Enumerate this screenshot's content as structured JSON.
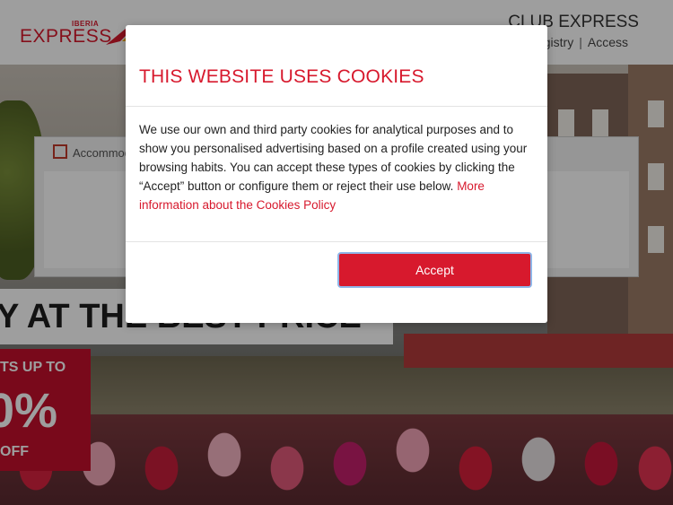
{
  "header": {
    "logo_small": "IBERIA",
    "logo_main": "EXPRESS",
    "club_title": "CLUB EXPRESS",
    "club_links": [
      "Registry",
      "Access"
    ]
  },
  "search": {
    "tab_label": "Accommodation"
  },
  "hero": {
    "headline": "Y AT THE BEST PRICE",
    "promo_line1": "TS UP TO",
    "promo_pct": "0%",
    "promo_off": "OFF"
  },
  "modal": {
    "title": "THIS WEBSITE USES COOKIES",
    "body_text": "We use our own and third party cookies for analytical purposes and to show you personalised advertising based on a profile created using your browsing habits. You can accept these types of cookies by clicking the “Accept” button or configure them or reject their use below. ",
    "link_text": "More information about the Cookies Policy",
    "accept_label": "Accept"
  },
  "colors": {
    "brand_red": "#d7192d",
    "promo_red": "#c3102d"
  }
}
